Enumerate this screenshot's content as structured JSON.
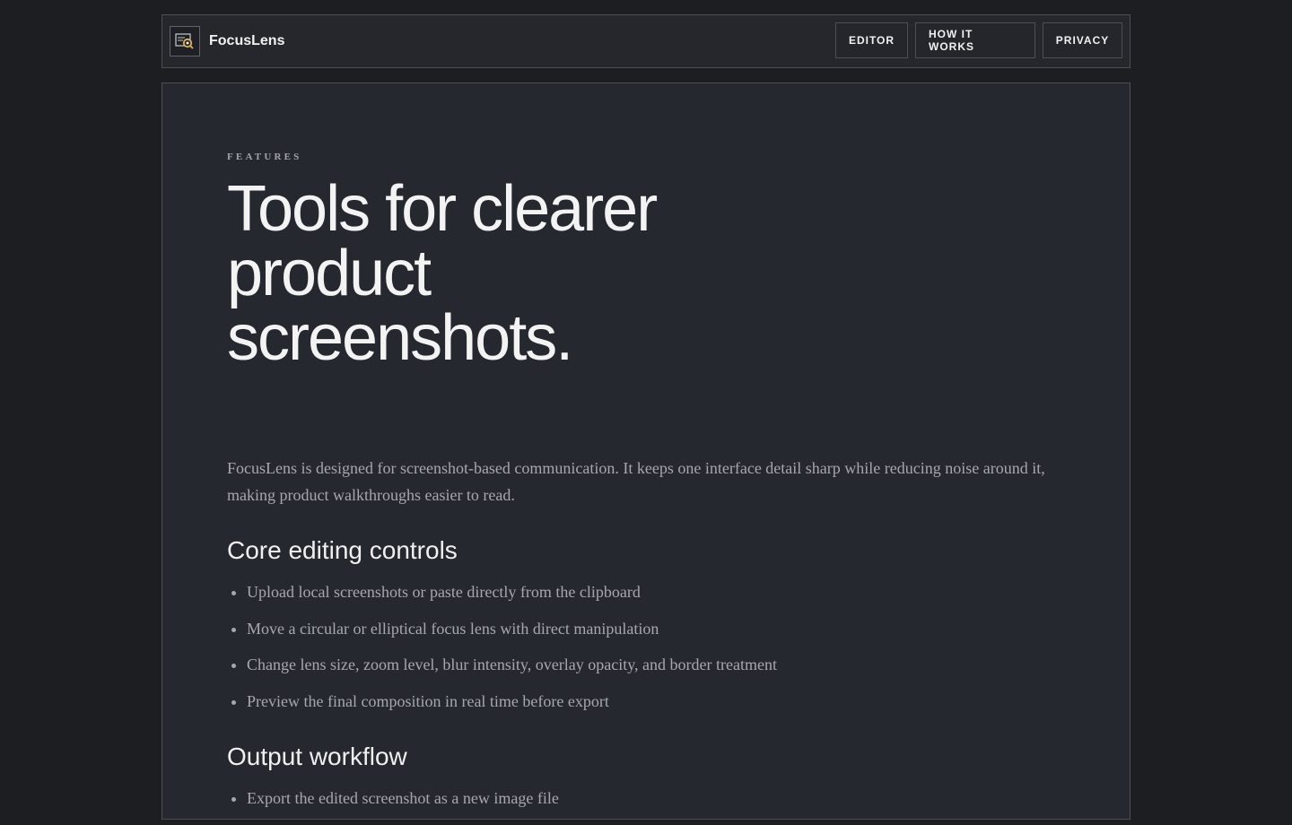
{
  "header": {
    "brand_name": "FocusLens",
    "logo_icon": "focus-lens-logo-icon",
    "nav": [
      {
        "label": "EDITOR"
      },
      {
        "label": "HOW IT WORKS"
      },
      {
        "label": "PRIVACY"
      }
    ]
  },
  "main": {
    "eyebrow": "FEATURES",
    "headline": "Tools for clearer product screenshots.",
    "intro": "FocusLens is designed for screenshot-based communication. It keeps one interface detail sharp while reducing noise around it, making product walkthroughs easier to read.",
    "sections": [
      {
        "title": "Core editing controls",
        "items": [
          "Upload local screenshots or paste directly from the clipboard",
          "Move a circular or elliptical focus lens with direct manipulation",
          "Change lens size, zoom level, blur intensity, overlay opacity, and border treatment",
          "Preview the final composition in real time before export"
        ]
      },
      {
        "title": "Output workflow",
        "items": [
          "Export the edited screenshot as a new image file"
        ]
      }
    ]
  },
  "colors": {
    "page_background": "#1d1e21",
    "panel_background": "#262830",
    "border": "#4d4f55",
    "accent_lens": "#e0b15a",
    "text_primary": "#f3f3f3",
    "text_muted": "#a7a8ad"
  }
}
